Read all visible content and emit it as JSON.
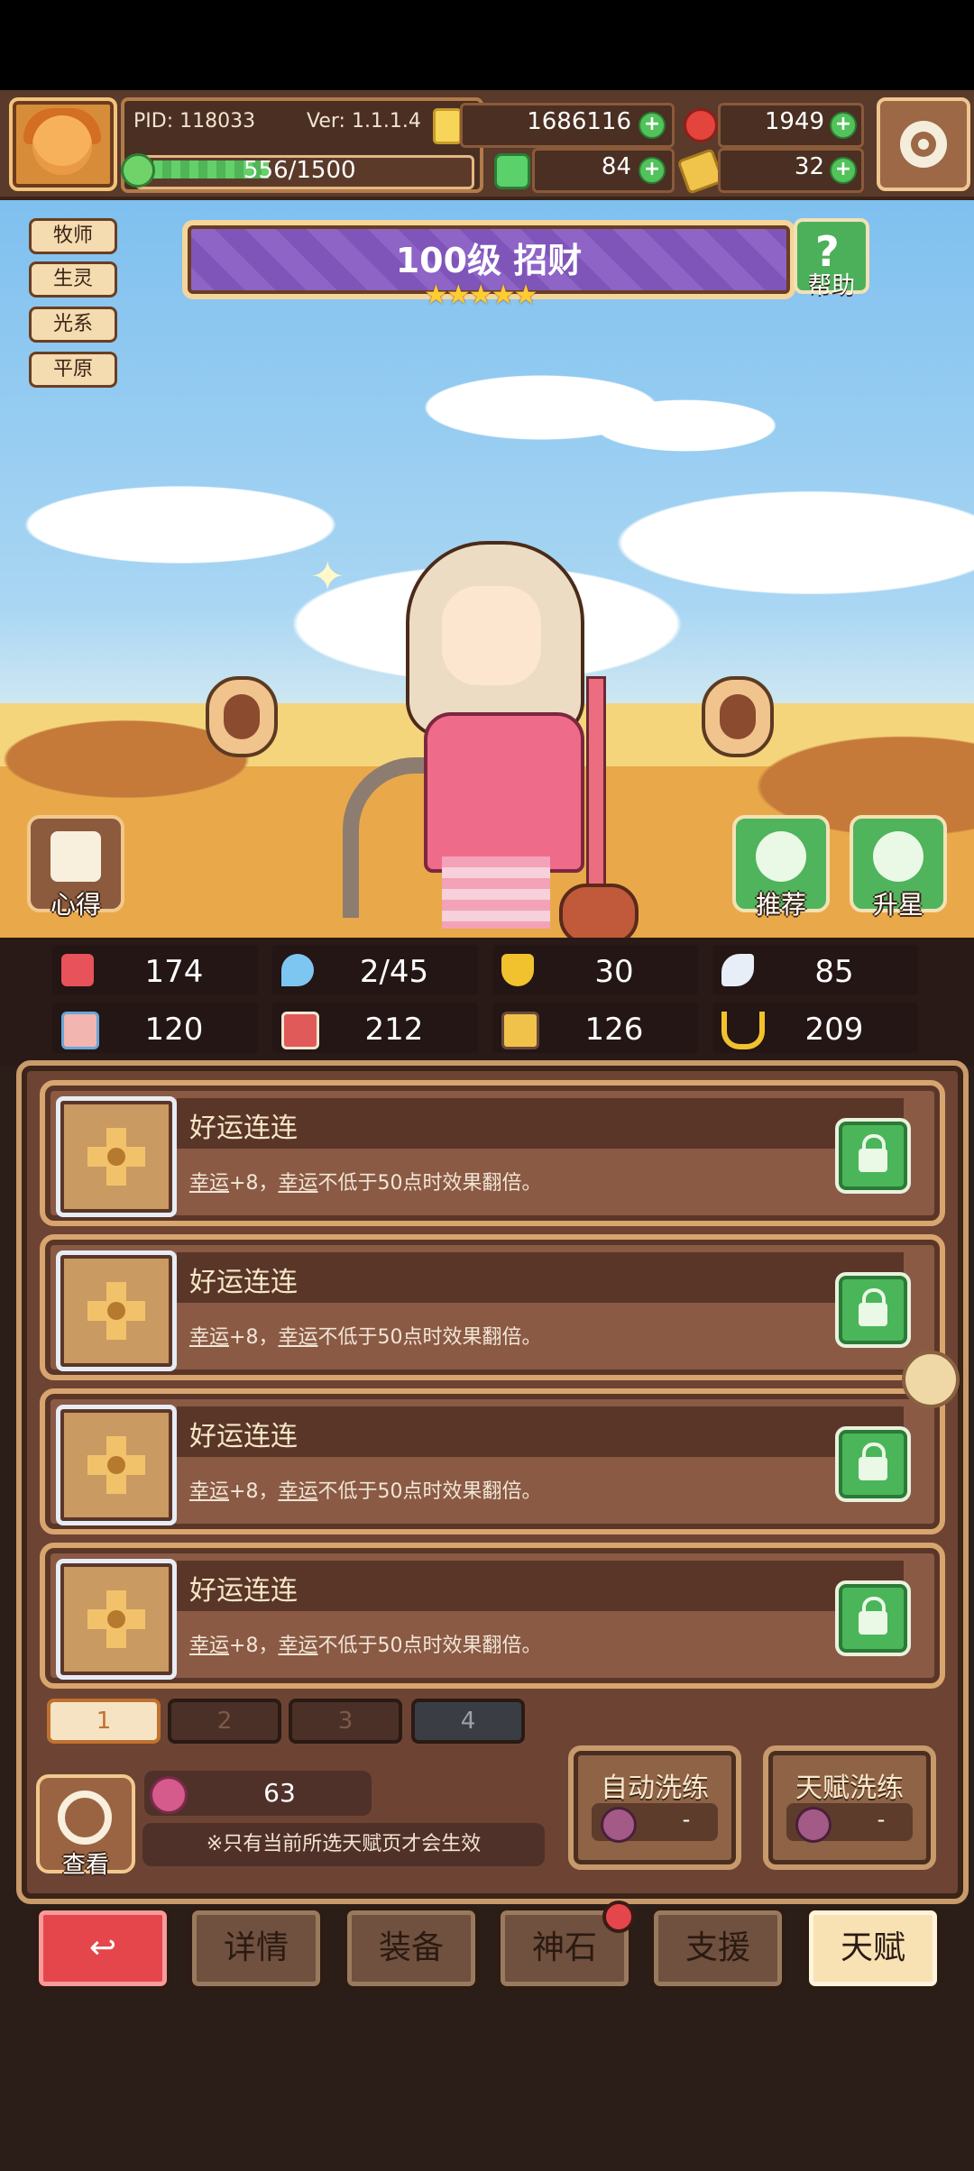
{
  "header": {
    "pid": "PID: 118033",
    "version": "Ver: 1.1.1.4",
    "exp": "556/1500",
    "exp_ratio": 0.37,
    "gold": "1686116",
    "ruby": "1949",
    "clover": "84",
    "keys": "32"
  },
  "hero": {
    "tags": [
      "牧师",
      "生灵",
      "光系",
      "平原"
    ],
    "title": "100级 招财",
    "stars": "★★★★★",
    "help_label": "帮助",
    "xinde_label": "心得",
    "recommend_label": "推荐",
    "upgrade_label": "升星"
  },
  "stats": [
    {
      "icon": "heart-icon",
      "value": "174",
      "color": "#e8525a"
    },
    {
      "icon": "water-drop-icon",
      "value": "2/45",
      "color": "#7ec6f2"
    },
    {
      "icon": "shield-icon",
      "value": "30",
      "color": "#f2c22e"
    },
    {
      "icon": "wing-icon",
      "value": "85",
      "color": "#e8eef7"
    },
    {
      "icon": "fist-icon",
      "value": "120",
      "color": "#f3b5b0"
    },
    {
      "icon": "book-icon",
      "value": "212",
      "color": "#e15a5a"
    },
    {
      "icon": "potion-icon",
      "value": "126",
      "color": "#f0c24a"
    },
    {
      "icon": "horseshoe-icon",
      "value": "209",
      "color": "#f2c22e"
    }
  ],
  "talents": [
    {
      "name": "好运连连",
      "desc_a": "幸运",
      "desc_b": "+8，",
      "desc_c": "幸运",
      "desc_d": "不低于50点时效果翻倍。"
    },
    {
      "name": "好运连连",
      "desc_a": "幸运",
      "desc_b": "+8，",
      "desc_c": "幸运",
      "desc_d": "不低于50点时效果翻倍。"
    },
    {
      "name": "好运连连",
      "desc_a": "幸运",
      "desc_b": "+8，",
      "desc_c": "幸运",
      "desc_d": "不低于50点时效果翻倍。"
    },
    {
      "name": "好运连连",
      "desc_a": "幸运",
      "desc_b": "+8，",
      "desc_c": "幸运",
      "desc_d": "不低于50点时效果翻倍。"
    }
  ],
  "pages": [
    "1",
    "2",
    "3",
    "4"
  ],
  "bottom": {
    "view_label": "查看",
    "potion_count": "63",
    "note": "※只有当前所选天赋页才会生效",
    "auto_wash": "自动洗练",
    "auto_wash_value": "-",
    "talent_wash": "天赋洗练",
    "talent_wash_value": "-"
  },
  "nav": {
    "detail": "详情",
    "equip": "装备",
    "stone": "神石",
    "support": "支援",
    "talent": "天赋"
  }
}
